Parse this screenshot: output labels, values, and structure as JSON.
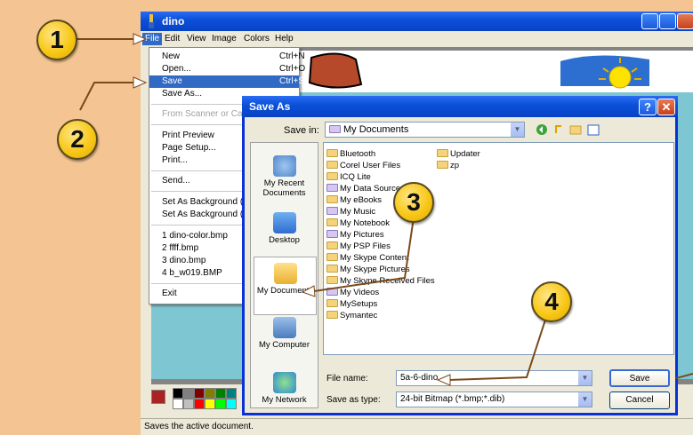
{
  "paint": {
    "title": "dino",
    "menus": [
      "File",
      "Edit",
      "View",
      "Image",
      "Colors",
      "Help"
    ],
    "status_text": "Saves the active document."
  },
  "file_menu": {
    "items": [
      {
        "label": "New",
        "shortcut": "Ctrl+N"
      },
      {
        "label": "Open...",
        "shortcut": "Ctrl+O"
      },
      {
        "label": "Save",
        "shortcut": "Ctrl+S",
        "selected": true
      },
      {
        "label": "Save As..."
      },
      {
        "label": "From Scanner or Cam",
        "disabled": true
      },
      {
        "label": "Print Preview"
      },
      {
        "label": "Page Setup..."
      },
      {
        "label": "Print..."
      },
      {
        "label": "Send..."
      },
      {
        "label": "Set As Background (T"
      },
      {
        "label": "Set As Background (C"
      },
      {
        "label": "1 dino-color.bmp"
      },
      {
        "label": "2 ffff.bmp"
      },
      {
        "label": "3 dino.bmp"
      },
      {
        "label": "4 b_w019.BMP"
      },
      {
        "label": "Exit"
      }
    ]
  },
  "save_dialog": {
    "title": "Save As",
    "help_glyph": "?",
    "close_glyph": "✕",
    "save_in_label": "Save in:",
    "save_in_value": "My Documents",
    "places": [
      "My Recent Documents",
      "Desktop",
      "My Documents",
      "My Computer",
      "My Network"
    ],
    "files_col1": [
      "Bluetooth",
      "Corel User Files",
      "ICQ Lite",
      "My Data Sources",
      "My eBooks",
      "My Music",
      "My Notebook",
      "My Pictures",
      "My PSP Files",
      "My Skype Content",
      "My Skype Pictures",
      "My Skype Received Files",
      "My Videos",
      "MySetups",
      "Symantec"
    ],
    "files_col2": [
      "Updater",
      "zp"
    ],
    "file_name_label": "File name:",
    "file_name_value": "5a-6-dino",
    "save_type_label": "Save as type:",
    "save_type_value": "24-bit Bitmap (*.bmp;*.dib)",
    "save_button": "Save",
    "cancel_button": "Cancel"
  },
  "callouts": [
    "1",
    "2",
    "3",
    "4"
  ],
  "colors": {
    "accent": "#316ac5",
    "title_blue": "#0a4fd8",
    "badge_yellow": "#f8c818",
    "background": "#f4c592"
  }
}
